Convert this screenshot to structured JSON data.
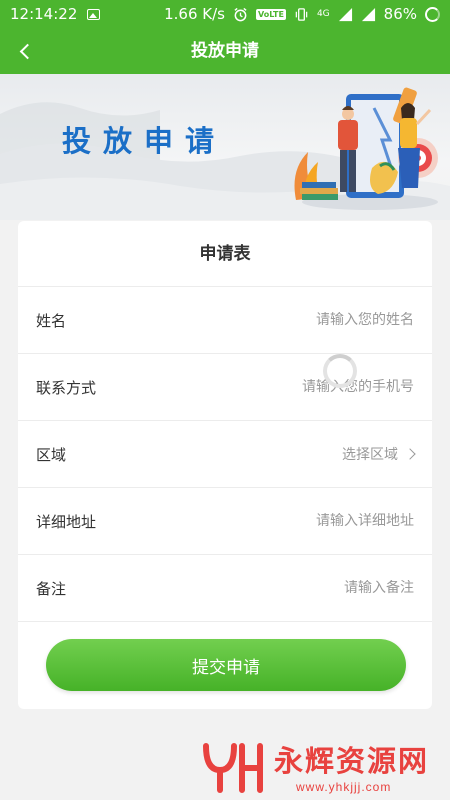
{
  "status_bar": {
    "time": "12:14:22",
    "network_speed": "1.66 K/s",
    "volte": "VoLTE",
    "signal_label": "4G",
    "battery": "86%"
  },
  "nav": {
    "title": "投放申请",
    "back_icon": "back-arrow-icon"
  },
  "banner": {
    "title": "投放申请"
  },
  "form": {
    "title": "申请表",
    "fields": [
      {
        "label": "姓名",
        "placeholder": "请输入您的姓名"
      },
      {
        "label": "联系方式",
        "placeholder": "请输入您的手机号"
      },
      {
        "label": "区域",
        "value": "选择区域"
      },
      {
        "label": "详细地址",
        "placeholder": "请输入详细地址"
      },
      {
        "label": "备注",
        "placeholder": "请输入备注"
      }
    ],
    "submit_label": "提交申请"
  },
  "watermark": {
    "name": "永辉资源网",
    "url": "www.yhkjjj.com"
  },
  "colors": {
    "brand_green": "#4cb52f",
    "banner_title_blue": "#1b6fc7",
    "watermark_red": "#e8423f"
  }
}
